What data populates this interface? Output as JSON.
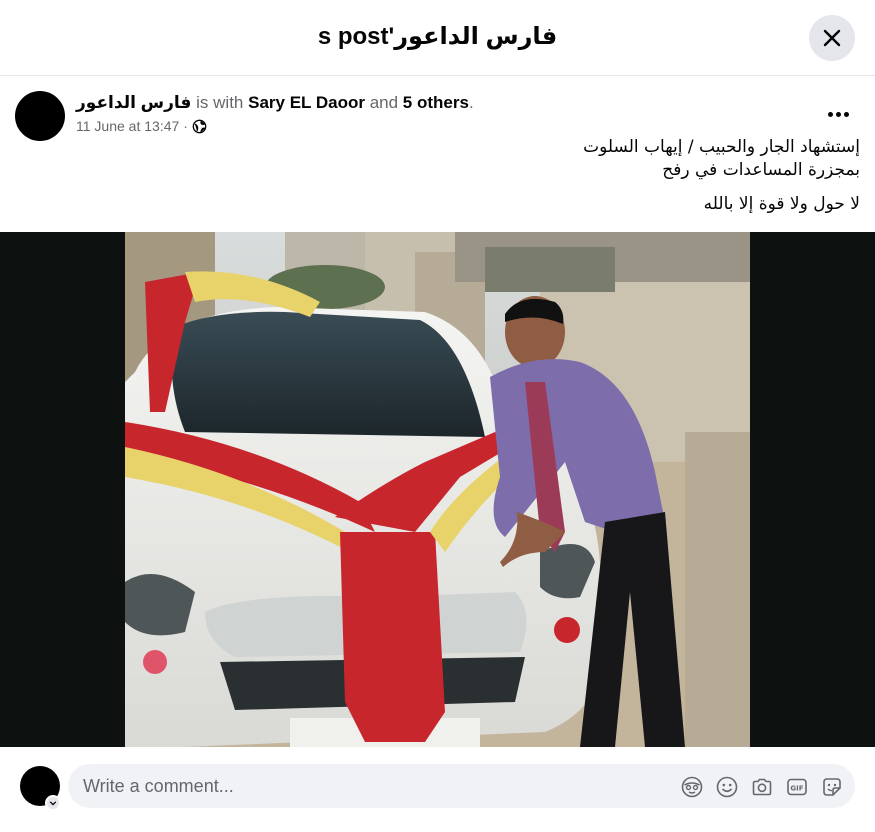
{
  "header": {
    "title": "فارس الداعور's post"
  },
  "post": {
    "author": "فارس الداعور",
    "with_text": "is with",
    "tagged": "Sary EL Daoor",
    "and_text": "and",
    "others": "5 others",
    "period": ".",
    "timestamp": "11 June at 13:47",
    "dot": "·",
    "privacy_icon": "globe-icon",
    "text_lines": [
      "إستشهاد  الجار والحبيب  /  إيهاب السلوت",
      "بمجزرة المساعدات في رفح",
      "لا حول ولا قوة إلا بالله"
    ]
  },
  "comment": {
    "placeholder": "Write a comment...",
    "icons": [
      "avatar-sticker-icon",
      "emoji-icon",
      "camera-icon",
      "gif-icon",
      "sticker-icon"
    ]
  },
  "colors": {
    "accent_bg": "#e4e6eb",
    "input_bg": "#f0f2f5",
    "muted_text": "#65676b",
    "media_bg": "#0d1211"
  }
}
